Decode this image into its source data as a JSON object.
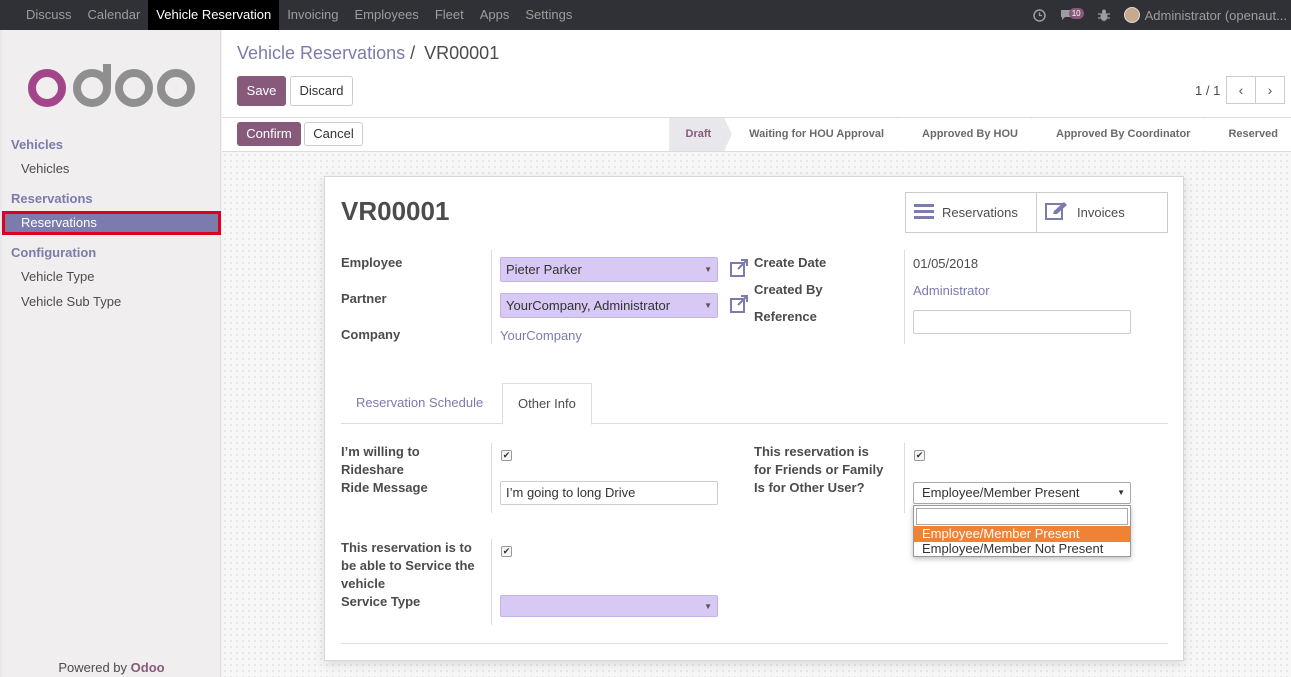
{
  "topbar": {
    "menu": [
      "Discuss",
      "Calendar",
      "Vehicle Reservation",
      "Invoicing",
      "Employees",
      "Fleet",
      "Apps",
      "Settings"
    ],
    "active_menu": "Vehicle Reservation",
    "message_count": "10",
    "user": "Administrator (openaut..."
  },
  "sidebar": {
    "logo": "odoo",
    "sections": [
      {
        "title": "Vehicles",
        "items": [
          "Vehicles"
        ]
      },
      {
        "title": "Reservations",
        "items": [
          "Reservations"
        ]
      },
      {
        "title": "Configuration",
        "items": [
          "Vehicle Type",
          "Vehicle Sub Type"
        ]
      }
    ],
    "powered_prefix": "Powered by",
    "powered_brand": "Odoo"
  },
  "control": {
    "breadcrumb_parent": "Vehicle Reservations",
    "breadcrumb_sep": "/",
    "breadcrumb_current": "VR00001",
    "save_label": "Save",
    "discard_label": "Discard",
    "pager": "1 / 1"
  },
  "statusbar": {
    "confirm_label": "Confirm",
    "cancel_label": "Cancel",
    "stages": [
      "Draft",
      "Waiting for HOU Approval",
      "Approved By HOU",
      "Approved By Coordinator",
      "Reserved"
    ],
    "current_stage": "Draft"
  },
  "form": {
    "title": "VR00001",
    "smart_buttons": {
      "reservations": "Reservations",
      "invoices": "Invoices"
    },
    "labels": {
      "employee": "Employee",
      "partner": "Partner",
      "company": "Company",
      "create_date": "Create Date",
      "created_by": "Created By",
      "reference": "Reference"
    },
    "values": {
      "employee": "Pieter Parker",
      "partner": "YourCompany, Administrator",
      "company": "YourCompany",
      "create_date": "01/05/2018",
      "created_by": "Administrator",
      "reference": ""
    },
    "tabs": [
      "Reservation Schedule",
      "Other Info"
    ],
    "active_tab": "Other Info",
    "other_info": {
      "rideshare_label_1": "I’m willing to",
      "rideshare_label_2": "Rideshare",
      "ride_message_label": "Ride Message",
      "ride_message_value": "I’m going to long Drive",
      "friends_label_1": "This reservation is",
      "friends_label_2": "for Friends or Family",
      "other_user_label": "Is for Other User?",
      "other_user_value": "Employee/Member Present",
      "service_label_1": "This reservation is to",
      "service_label_2": "be able to Service the",
      "service_label_3": "vehicle",
      "service_type_label": "Service Type",
      "service_type_value": "",
      "checkbox_rideshare": true,
      "checkbox_friends": true,
      "checkbox_service": true
    },
    "dropdown_options": [
      "Employee/Member Present",
      "Employee/Member Not Present"
    ],
    "dropdown_highlighted": "Employee/Member Present"
  }
}
